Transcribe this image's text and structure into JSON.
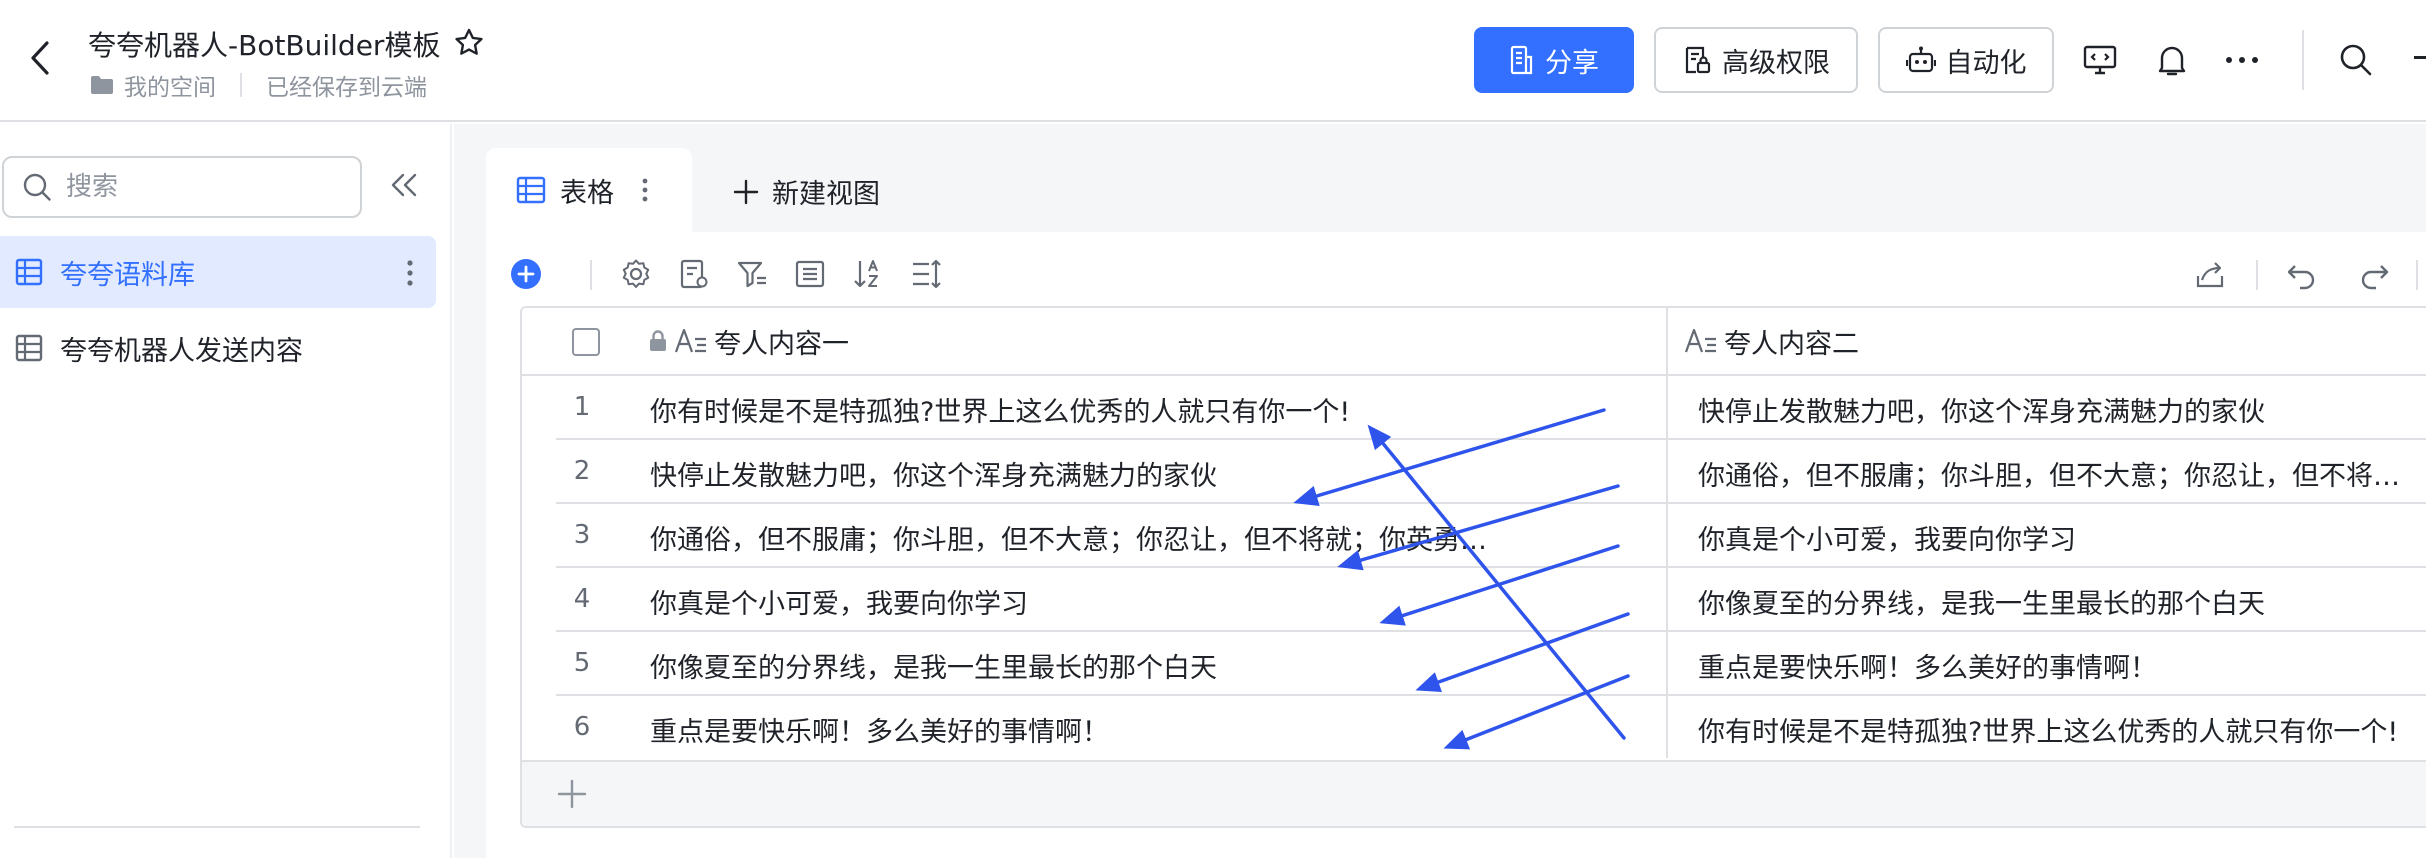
{
  "header": {
    "title": "夸夸机器人-BotBuilder模板",
    "breadcrumb_space": "我的空间",
    "save_status": "已经保存到云端",
    "share_label": "分享",
    "permissions_label": "高级权限",
    "automation_label": "自动化",
    "icons": [
      "back-arrow-icon",
      "star-icon",
      "folder-icon",
      "present-icon",
      "bell-icon",
      "more-icon",
      "search-icon"
    ]
  },
  "sidebar": {
    "search_placeholder": "搜索",
    "items": [
      {
        "label": "夸夸语料库",
        "active": true
      },
      {
        "label": "夸夸机器人发送内容",
        "active": false
      }
    ]
  },
  "view_tabs": {
    "table_label": "表格",
    "new_view_label": "新建视图"
  },
  "table": {
    "columns": [
      "夸人内容一",
      "夸人内容二"
    ],
    "rows": [
      {
        "num": "1",
        "col1": "你有时候是不是特孤独?世界上这么优秀的人就只有你一个!",
        "col2": "快停止发散魅力吧，你这个浑身充满魅力的家伙"
      },
      {
        "num": "2",
        "col1": "快停止发散魅力吧，你这个浑身充满魅力的家伙",
        "col2": "你通俗，但不服庸；你斗胆，但不大意；你忍让，但不将就..."
      },
      {
        "num": "3",
        "col1": "你通俗，但不服庸；你斗胆，但不大意；你忍让，但不将就；你英勇，但...",
        "col2": "你真是个小可爱，我要向你学习"
      },
      {
        "num": "4",
        "col1": "你真是个小可爱，我要向你学习",
        "col2": "你像夏至的分界线，是我一生里最长的那个白天"
      },
      {
        "num": "5",
        "col1": "你像夏至的分界线，是我一生里最长的那个白天",
        "col2": "重点是要快乐啊！多么美好的事情啊！"
      },
      {
        "num": "6",
        "col1": "重点是要快乐啊！多么美好的事情啊！",
        "col2": "你有时候是不是特孤独?世界上这么优秀的人就只有你一个!"
      }
    ]
  },
  "colors": {
    "accent": "#3370ff",
    "annotation_arrow": "#2f54eb",
    "border": "#dee0e3",
    "text": "#1f2329",
    "muted": "#8f959e"
  }
}
